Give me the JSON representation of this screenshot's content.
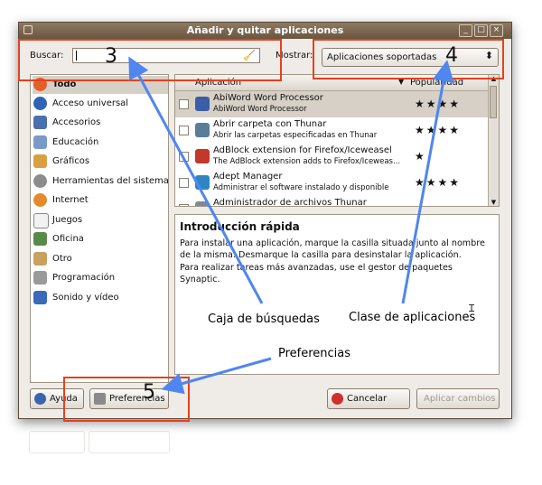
{
  "window": {
    "title": "Añadir y quitar aplicaciones",
    "buttons": [
      "_",
      "□",
      "×"
    ]
  },
  "search": {
    "label": "Buscar:",
    "value": ""
  },
  "show": {
    "label": "Mostrar:",
    "selected": "Aplicaciones soportadas"
  },
  "categories": [
    "Todo",
    "Acceso universal",
    "Accesorios",
    "Educación",
    "Gráficos",
    "Herramientas del sistema",
    "Internet",
    "Juegos",
    "Oficina",
    "Otro",
    "Programación",
    "Sonido y vídeo"
  ],
  "columns": {
    "application": "Aplicación",
    "popularity": "Popularidad"
  },
  "apps": [
    {
      "name": "AbiWord Word Processor",
      "desc": "AbiWord Word Processor",
      "stars": "★★★★",
      "color": "#3a5fa8"
    },
    {
      "name": "Abrir carpeta con Thunar",
      "desc": "Abrir las carpetas especificadas en Thunar",
      "stars": "★★★★",
      "color": "#5a7d9a"
    },
    {
      "name": "AdBlock extension for Firefox/Iceweasel",
      "desc": "The AdBlock extension adds to Firefox/Iceweas...",
      "stars": "★",
      "color": "#c0392b"
    },
    {
      "name": "Adept Manager",
      "desc": "Administrar el software instalado y disponible",
      "stars": "★★★★",
      "color": "#2e86c1"
    },
    {
      "name": "Administrador de archivos Thunar",
      "desc": "",
      "stars": "",
      "color": "#7a8a99"
    }
  ],
  "quickstart": {
    "heading": "Introducción rápida",
    "lines": [
      "Para instalar una aplicación, marque la casilla situada junto al nombre",
      "de la misma. Desmarque la casilla para desinstalar la aplicación.",
      "Para realizar tareas más avanzadas, use el gestor de paquetes",
      "Synaptic."
    ]
  },
  "buttons": {
    "help": "Ayuda",
    "preferences": "Preferencias",
    "cancel": "Cancelar",
    "apply": "Aplicar cambios"
  },
  "annotations": {
    "n3": "3",
    "n4": "4",
    "n5": "5",
    "search_box": "Caja de búsquedas",
    "app_class": "Clase de aplicaciones",
    "preferences": "Preferencias"
  },
  "colors": {
    "highlight": "#e8401c",
    "arrow": "#4f86f0",
    "titlebar": "#7a6650"
  }
}
